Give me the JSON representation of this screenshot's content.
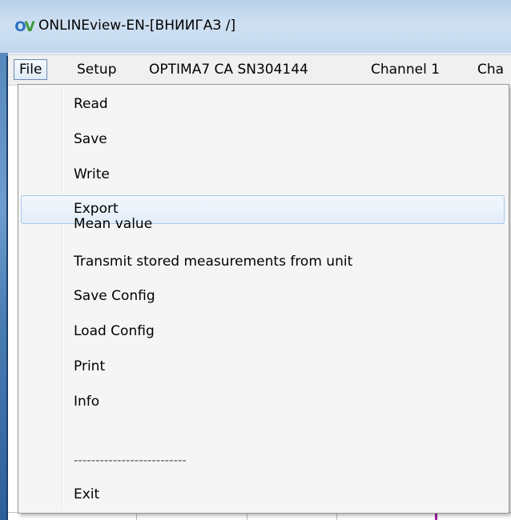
{
  "window": {
    "title": "ONLINEview-EN-[ВНИИГАЗ         /]",
    "icon": "app-logo-icon"
  },
  "menubar": {
    "items": [
      {
        "label": "File",
        "active": true
      },
      {
        "label": "Setup"
      },
      {
        "label": "OPTIMA7 CA SN304144"
      },
      {
        "label": "Channel 1"
      },
      {
        "label": "Cha"
      }
    ]
  },
  "file_menu": {
    "items": [
      {
        "label": "Read"
      },
      {
        "label": "Save"
      },
      {
        "label": "Write"
      },
      {
        "label": "Export",
        "highlighted": true
      },
      {
        "label": "Mean value"
      },
      {
        "label": "Transmit stored measurements from unit"
      },
      {
        "label": "Save Config"
      },
      {
        "label": "Load Config"
      },
      {
        "label": "Print"
      },
      {
        "label": "Info"
      }
    ],
    "separator_text": "--------------------------",
    "exit_label": "Exit"
  },
  "colors": {
    "frame_blue": "#4f82b8",
    "menu_bg": "#f5f5f5",
    "highlight_border": "#a8c8ec",
    "highlight_fill": "#e3edf9"
  }
}
